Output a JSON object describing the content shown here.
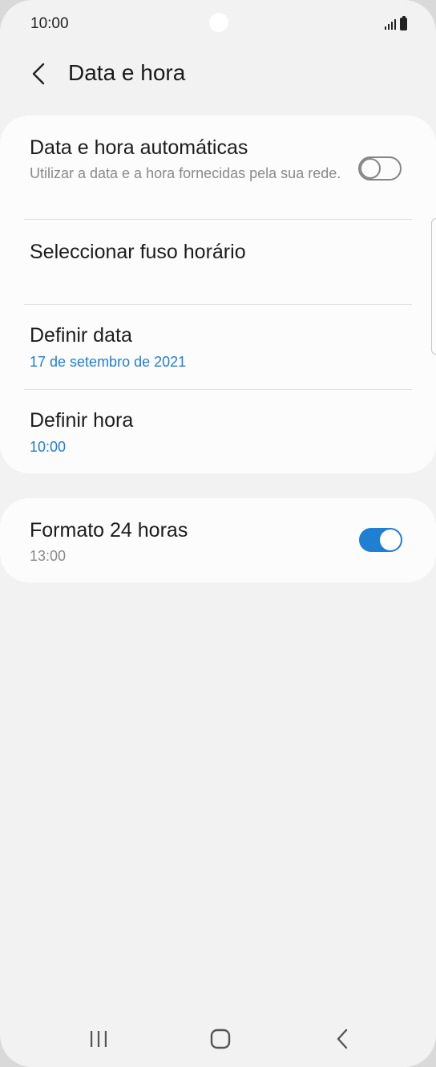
{
  "status_bar": {
    "time": "10:00"
  },
  "header": {
    "title": "Data e hora",
    "back_icon": "chevron-left-icon"
  },
  "settings": {
    "auto_datetime": {
      "title": "Data e hora automáticas",
      "subtitle": "Utilizar a data e a hora fornecidas pela sua rede.",
      "enabled": false
    },
    "timezone": {
      "title": "Seleccionar fuso horário"
    },
    "set_date": {
      "title": "Definir data",
      "value": "17 de setembro de 2021"
    },
    "set_time": {
      "title": "Definir hora",
      "value": "10:00"
    },
    "format_24h": {
      "title": "Formato 24 horas",
      "subtitle": "13:00",
      "enabled": true
    }
  },
  "colors": {
    "accent": "#1f7fd1",
    "background": "#f2f2f2",
    "card": "#fcfcfc"
  },
  "nav_bar": {
    "icons": [
      "recents-icon",
      "home-icon",
      "back-icon"
    ]
  }
}
